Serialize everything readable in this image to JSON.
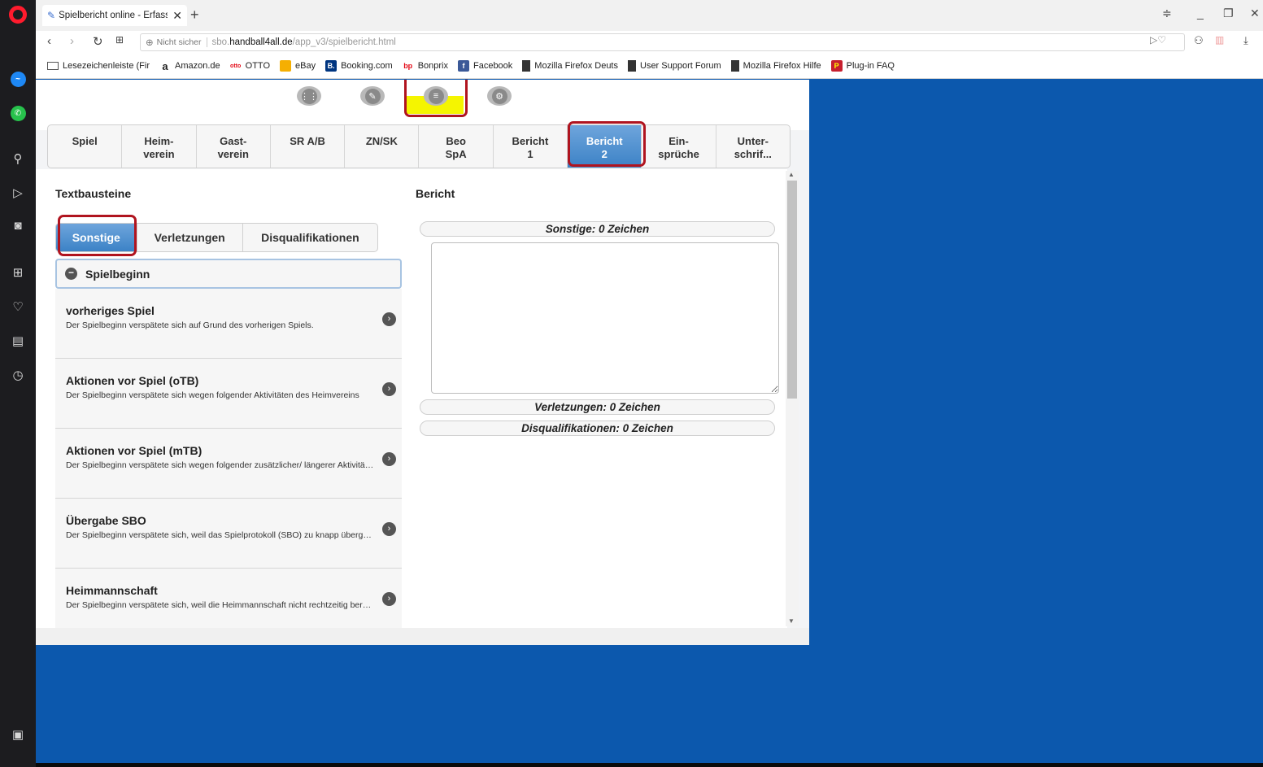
{
  "sidebar": {
    "icons": [
      "opera-logo-icon",
      "messenger-icon",
      "whatsapp-icon",
      "search-icon",
      "send-icon",
      "camera-icon",
      "speed-dial-icon",
      "heart-icon",
      "news-icon",
      "history-icon",
      "sidebar-toggle-icon"
    ]
  },
  "browser": {
    "tab_title": "Spielbericht online - Erfass",
    "tab_close": "✕",
    "new_tab": "+",
    "url_not_secure": "Nicht sicher",
    "url_host": "sbo.",
    "url_domain": "handball4all.de",
    "url_path": "/app_v3/spielbericht.html",
    "bookmarks": [
      {
        "label": "Lesezeichenleiste (Fir",
        "icon": "folder-icon"
      },
      {
        "label": "Amazon.de",
        "icon": "amazon-icon"
      },
      {
        "label": "OTTO",
        "icon": "otto-icon"
      },
      {
        "label": "eBay",
        "icon": "ebay-icon"
      },
      {
        "label": "Booking.com",
        "icon": "booking-icon"
      },
      {
        "label": "Bonprix",
        "icon": "bonprix-icon"
      },
      {
        "label": "Facebook",
        "icon": "facebook-icon"
      },
      {
        "label": "Mozilla Firefox Deuts",
        "icon": "page-icon"
      },
      {
        "label": "User Support Forum",
        "icon": "page-icon"
      },
      {
        "label": "Mozilla Firefox Hilfe",
        "icon": "page-icon"
      },
      {
        "label": "Plug-in FAQ",
        "icon": "plugin-icon"
      }
    ]
  },
  "app": {
    "top_icons": [
      "grid-icon",
      "edit-icon",
      "list-icon",
      "settings-icon"
    ],
    "nav_tabs": [
      {
        "label": "Spiel"
      },
      {
        "label": "Heim-\nverein"
      },
      {
        "label": "Gast-\nverein"
      },
      {
        "label": "SR A/B"
      },
      {
        "label": "ZN/SK"
      },
      {
        "label": "Beo\nSpA"
      },
      {
        "label": "Bericht\n1"
      },
      {
        "label": "Bericht\n2",
        "active": true
      },
      {
        "label": "Ein-\nsprüche"
      },
      {
        "label": "Unter-\nschrif..."
      }
    ],
    "left_heading": "Textbausteine",
    "right_heading": "Bericht",
    "sub_tabs": [
      "Sonstige",
      "Verletzungen",
      "Disqualifikationen"
    ],
    "active_sub_tab": "Sonstige",
    "section_title": "Spielbeginn",
    "items": [
      {
        "title": "vorheriges Spiel",
        "desc": "Der Spielbeginn verspätete sich auf Grund des vorherigen Spiels."
      },
      {
        "title": "Aktionen vor Spiel (oTB)",
        "desc": "Der Spielbeginn verspätete sich wegen folgender Aktivitäten des Heimvereins"
      },
      {
        "title": "Aktionen vor Spiel (mTB)",
        "desc": "Der Spielbeginn verspätete sich wegen folgender zusätzlicher/ längerer Aktivitäten"
      },
      {
        "title": "Übergabe SBO",
        "desc": "Der Spielbeginn verspätete sich, weil das Spielprotokoll (SBO) zu knapp übergeben wurde"
      },
      {
        "title": "Heimmannschaft",
        "desc": "Der Spielbeginn verspätete sich, weil die Heimmannschaft nicht rechtzeitig bereit war"
      }
    ],
    "report": {
      "sonstige": "Sonstige: 0 Zeichen",
      "verletzungen": "Verletzungen: 0 Zeichen",
      "disqualifikationen": "Disqualifikationen: 0 Zeichen",
      "textarea_value": ""
    }
  },
  "colors": {
    "desktop": "#0c58ad",
    "active_tab": "#3c82c6",
    "highlight_box": "#b0141f",
    "highlight_yellow": "#f5f500"
  }
}
